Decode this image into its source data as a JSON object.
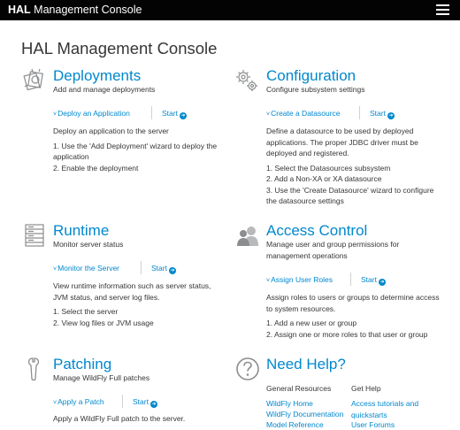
{
  "header": {
    "brand_bold": "HAL",
    "brand_rest": " Management Console"
  },
  "page_title": "HAL Management Console",
  "sections": {
    "deployments": {
      "title": "Deployments",
      "subtitle": "Add and manage deployments",
      "action": "Deploy an Application",
      "start": "Start",
      "body": [
        "Deploy an application to the server",
        "1. Use the 'Add Deployment' wizard to deploy the application",
        "2. Enable the deployment"
      ]
    },
    "configuration": {
      "title": "Configuration",
      "subtitle": "Configure subsystem settings",
      "action": "Create a Datasource",
      "start": "Start",
      "body": [
        "Define a datasource to be used by deployed applications. The proper JDBC driver must be deployed and registered.",
        "1. Select the Datasources subsystem",
        "2. Add a Non-XA or XA datasource",
        "3. Use the 'Create Datasource' wizard to configure the datasource settings"
      ]
    },
    "runtime": {
      "title": "Runtime",
      "subtitle": "Monitor server status",
      "action": "Monitor the Server",
      "start": "Start",
      "body": [
        "View runtime information such as server status, JVM status, and server log files.",
        "1. Select the server",
        "2. View log files or JVM usage"
      ]
    },
    "access": {
      "title": "Access Control",
      "subtitle": "Manage user and group permissions for management operations",
      "action": "Assign User Roles",
      "start": "Start",
      "body": [
        "Assign roles to users or groups to determine access to system resources.",
        "1. Add a new user or group",
        "2. Assign one or more roles to that user or group"
      ]
    },
    "patching": {
      "title": "Patching",
      "subtitle": "Manage WildFly Full patches",
      "action": "Apply a Patch",
      "start": "Start",
      "body": [
        "Apply a WildFly Full patch to the server."
      ]
    },
    "help": {
      "title": "Need Help?",
      "col1_title": "General Resources",
      "col1_links": [
        "WildFly Home",
        "WildFly Documentation",
        "Model Reference"
      ],
      "col2_title": "Get Help",
      "col2_links": [
        "Access tutorials and quickstarts",
        "User Forums"
      ]
    }
  },
  "colors": {
    "accent": "#0088ce",
    "topbar": "#030303",
    "text": "#363636",
    "icon": "#8b8d8f"
  },
  "icons": {
    "deployments": "deployments-icon",
    "configuration": "gears-icon",
    "runtime": "server-icon",
    "access": "users-icon",
    "patching": "wrench-icon",
    "help": "question-circle-icon"
  }
}
